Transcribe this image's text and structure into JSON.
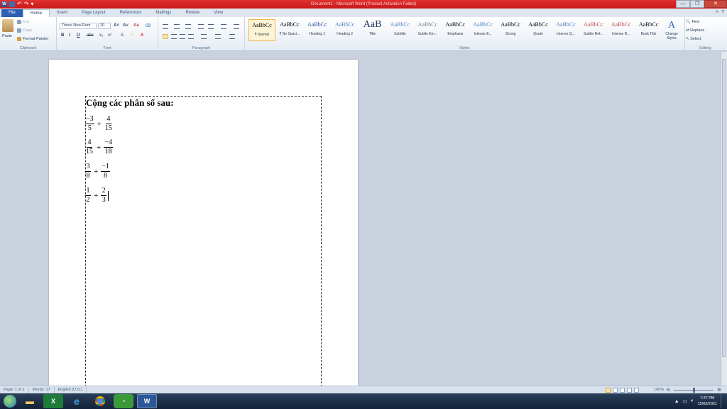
{
  "window": {
    "title": "Document1 - Microsoft Word (Product Activation Failed)",
    "min_label": "—",
    "max_label": "❐",
    "close_label": "✕"
  },
  "tabs": [
    {
      "label": "File"
    },
    {
      "label": "Home"
    },
    {
      "label": "Insert"
    },
    {
      "label": "Page Layout"
    },
    {
      "label": "References"
    },
    {
      "label": "Mailings"
    },
    {
      "label": "Review"
    },
    {
      "label": "View"
    }
  ],
  "ribbon": {
    "clipboard": {
      "paste": "Paste",
      "cut": "Cut",
      "copy": "Copy",
      "format_painter": "Format Painter",
      "label": "Clipboard"
    },
    "font": {
      "font_name": "Times New Rom",
      "font_size": "20",
      "grow": "A˄",
      "shrink": "A˅",
      "bold": "B",
      "italic": "I",
      "underline": "U",
      "strike": "abc",
      "subscript": "x₂",
      "superscript": "x²",
      "label": "Font"
    },
    "paragraph": {
      "label": "Paragraph"
    },
    "styles": {
      "label": "Styles",
      "items": [
        {
          "sample": "AaBbCc",
          "name": "¶ Normal",
          "color": "#000000"
        },
        {
          "sample": "AaBbCc",
          "name": "¶ No Spaci...",
          "color": "#000000"
        },
        {
          "sample": "AaBbCc",
          "name": "Heading 1",
          "color": "#2a5597"
        },
        {
          "sample": "AaBbCc",
          "name": "Heading 2",
          "color": "#4f81bd"
        },
        {
          "sample": "AaB",
          "name": "Title",
          "color": "#17365d"
        },
        {
          "sample": "AaBbCc",
          "name": "Subtitle",
          "color": "#4f81bd"
        },
        {
          "sample": "AaBbCc",
          "name": "Subtle Em...",
          "color": "#808080"
        },
        {
          "sample": "AaBbCc",
          "name": "Emphasis",
          "color": "#000000"
        },
        {
          "sample": "AaBbCc",
          "name": "Intense E...",
          "color": "#4f81bd"
        },
        {
          "sample": "AaBbCc",
          "name": "Strong",
          "color": "#000000"
        },
        {
          "sample": "AaBbCc",
          "name": "Quote",
          "color": "#000000"
        },
        {
          "sample": "AaBbCc",
          "name": "Intense Q...",
          "color": "#4f81bd"
        },
        {
          "sample": "AaBbCc",
          "name": "Subtle Ref...",
          "color": "#c0504d"
        },
        {
          "sample": "AaBbCc",
          "name": "Intense R...",
          "color": "#c0504d"
        },
        {
          "sample": "AaBbCc",
          "name": "Book Title",
          "color": "#000000"
        }
      ]
    },
    "change_styles": "Change Styles",
    "editing": {
      "find": "Find",
      "replace": "Replace",
      "select": "Select",
      "label": "Editing"
    }
  },
  "document": {
    "heading": "Cộng các phân số sau:",
    "expressions": [
      {
        "a_num": "−3",
        "a_den": "5",
        "b_num": "4",
        "b_den": "15"
      },
      {
        "a_num": "4",
        "a_den": "15",
        "b_num": "−4",
        "b_den": "18"
      },
      {
        "a_num": "3",
        "a_den": "8",
        "b_num": "−1",
        "b_den": "8"
      },
      {
        "a_num": "1",
        "a_den": "2",
        "b_num": "2",
        "b_den": "3"
      }
    ],
    "plus": "+"
  },
  "status": {
    "page": "Page: 1 of 1",
    "words": "Words: 17",
    "language": "English (U.S.)",
    "zoom": "100%",
    "zoom_fraction": 0.5
  },
  "taskbar": {
    "word_label": "W",
    "time": "7:27 PM",
    "date": "15/03/2021"
  }
}
